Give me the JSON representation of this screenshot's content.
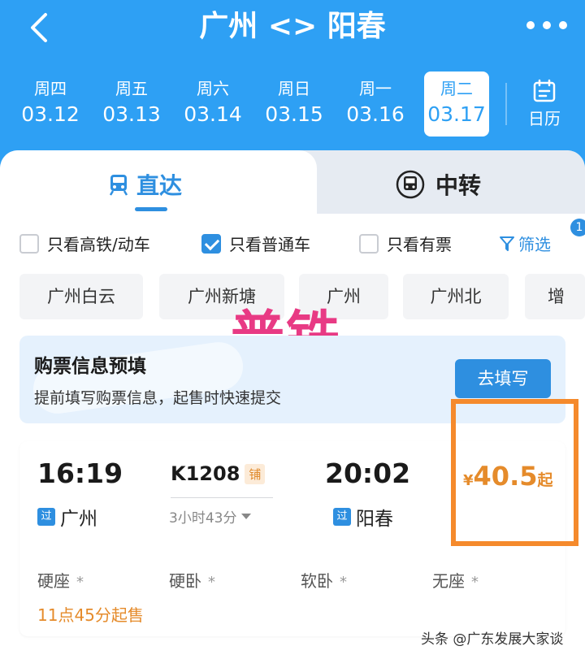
{
  "header": {
    "title": "广州 <> 阳春",
    "icons": {
      "back": "chevron-left-icon",
      "more": "more-dots-icon",
      "calendar": "calendar-icon"
    },
    "colors": {
      "bg": "#2ea0f4"
    }
  },
  "dates": [
    {
      "weekday": "周四",
      "date": "03.12",
      "active": false
    },
    {
      "weekday": "周五",
      "date": "03.13",
      "active": false
    },
    {
      "weekday": "周六",
      "date": "03.14",
      "active": false
    },
    {
      "weekday": "周日",
      "date": "03.15",
      "active": false
    },
    {
      "weekday": "周一",
      "date": "03.16",
      "active": false
    },
    {
      "weekday": "周二",
      "date": "03.17",
      "active": true
    }
  ],
  "calendar": {
    "label": "日历"
  },
  "tabs": {
    "direct": "直达",
    "transfer": "中转",
    "active": "direct"
  },
  "filters": {
    "gaotie": {
      "label": "只看高铁/动车",
      "checked": false
    },
    "putong": {
      "label": "只看普通车",
      "checked": true
    },
    "youpiao": {
      "label": "只看有票",
      "checked": false
    },
    "filter_label": "筛选",
    "filter_badge": "1"
  },
  "stations": [
    "广州白云",
    "广州新塘",
    "广州",
    "广州北",
    "增"
  ],
  "overlay": {
    "text": "普铁",
    "color": "#e83a84"
  },
  "banner": {
    "title": "购票信息预填",
    "subtitle": "提前填写购票信息，起售时快速提交",
    "button": "去填写"
  },
  "train": {
    "depart_time": "16:19",
    "depart_station": "广州",
    "depart_tag": "过",
    "arrive_time": "20:02",
    "arrive_station": "阳春",
    "arrive_tag": "过",
    "train_no": "K1208",
    "berth_tag": "铺",
    "duration": "3小时43分",
    "price": {
      "currency": "¥",
      "value": "40.5",
      "suffix": "起"
    },
    "seats": [
      {
        "name": "硬座",
        "mark": "*"
      },
      {
        "name": "硬卧",
        "mark": "*"
      },
      {
        "name": "软卧",
        "mark": "*"
      },
      {
        "name": "无座",
        "mark": "*"
      }
    ],
    "sale_time": "11点45分起售"
  },
  "watermark": "头条 @广东发展大家谈",
  "colors": {
    "accent": "#2e8fe0",
    "price": "#e58b2b",
    "highlight": "#f58a2c"
  }
}
